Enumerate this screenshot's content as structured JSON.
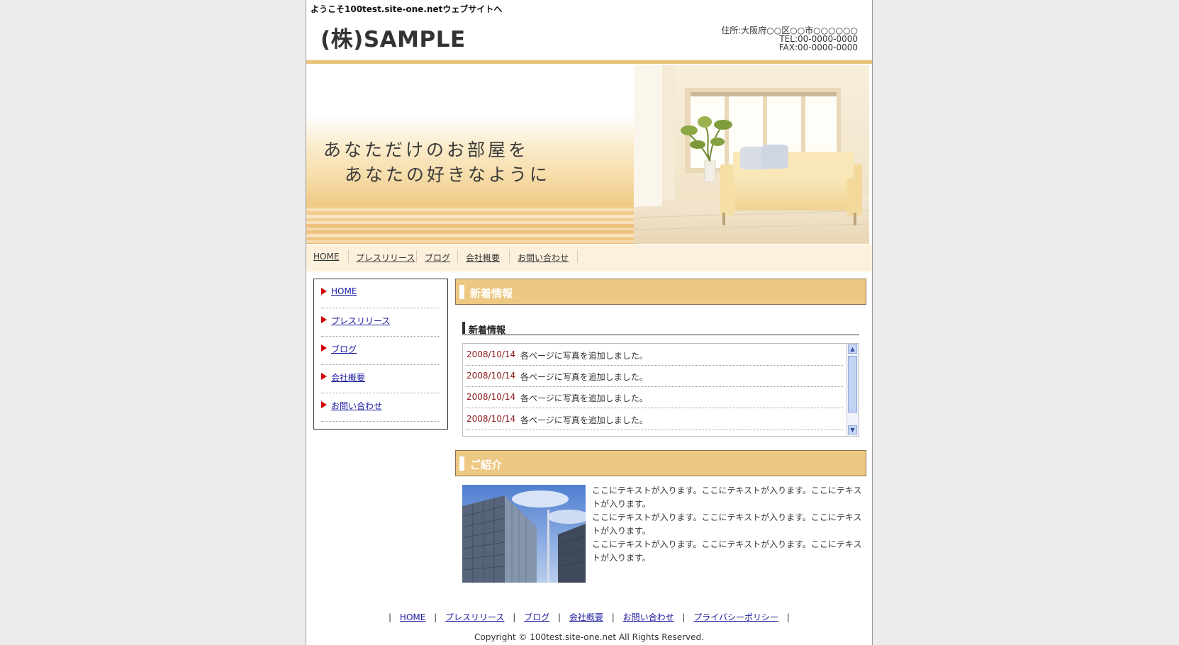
{
  "header": {
    "welcome": "ようこそ100test.site-one.netウェブサイトへ",
    "logo": "(株)SAMPLE",
    "address": "住所:大阪府○○区○○市○○○○○○",
    "tel": "TEL:00-0000-0000",
    "fax": "FAX:00-0000-0000"
  },
  "hero": {
    "line1": "あなただけのお部屋を",
    "line2": "あなたの好きなように"
  },
  "nav": [
    "HOME",
    "プレスリリース",
    "ブログ",
    "会社概要",
    "お問い合わせ"
  ],
  "sidebar": [
    "HOME",
    "プレスリリース",
    "ブログ",
    "会社概要",
    "お問い合わせ"
  ],
  "news_section": {
    "title": "新着情報",
    "subtitle": "新着情報",
    "items": [
      {
        "date": "2008/10/14",
        "text": "各ページに写真を追加しました。"
      },
      {
        "date": "2008/10/14",
        "text": "各ページに写真を追加しました。"
      },
      {
        "date": "2008/10/14",
        "text": "各ページに写真を追加しました。"
      },
      {
        "date": "2008/10/14",
        "text": "各ページに写真を追加しました。"
      }
    ]
  },
  "intro_section": {
    "title": "ご紹介",
    "paragraphs": [
      "ここにテキストが入ります。ここにテキストが入ります。ここにテキストが入ります。",
      "ここにテキストが入ります。ここにテキストが入ります。ここにテキストが入ります。",
      "ここにテキストが入ります。ここにテキストが入ります。ここにテキストが入ります。"
    ]
  },
  "footer": {
    "links": [
      "HOME",
      "プレスリリース",
      "ブログ",
      "会社概要",
      "お問い合わせ",
      "プライバシーポリシー"
    ],
    "copyright": "Copyright © 100test.site-one.net All Rights Reserved."
  },
  "colors": {
    "accent_gold": "#edc882",
    "nav_background": "#fdf1de",
    "arrow_red": "#d10000",
    "link_blue": "#1a1aa0",
    "news_date": "#8a1a1a"
  },
  "icons": {
    "sidebar_bullet": "red-triangle-arrow-icon",
    "scroll_up": "scroll-up-arrow-icon",
    "scroll_down": "scroll-down-arrow-icon"
  }
}
